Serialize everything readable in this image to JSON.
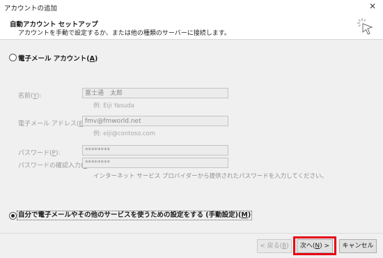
{
  "window": {
    "title": "アカウントの追加",
    "close_glyph": "✕"
  },
  "header": {
    "title": "自動アカウント セットアップ",
    "subtitle": "アカウントを手動で設定するか、または他の種類のサーバーに接続します。"
  },
  "options": {
    "email_account": {
      "label": "電子メール アカウント(",
      "key": "A",
      "close": ")",
      "selected": false
    },
    "manual": {
      "label": "自分で電子メールやその他のサービスを使うための設定をする (手動設定)(",
      "key": "M",
      "close": ")",
      "selected": true
    }
  },
  "form": {
    "name": {
      "label_pre": "名前(",
      "key": "Y",
      "label_post": "):",
      "value": "富士通　太郎",
      "hint": "例: Eiji Yasuda"
    },
    "email": {
      "label_pre": "電子メール アドレス(",
      "key": "E",
      "label_post": "):",
      "value": "fmv@fmworld.net",
      "hint": "例: eiji@contoso.com"
    },
    "password": {
      "label_pre": "パスワード(",
      "key": "P",
      "label_post": "):",
      "value": "********"
    },
    "password_confirm": {
      "label_pre": "パスワードの確認入力(",
      "key": "T",
      "label_post": "):",
      "value": "********"
    },
    "password_hint": "インターネット サービス プロバイダーから提供されたパスワードを入力してください。"
  },
  "buttons": {
    "back": {
      "pre": "< 戻る(",
      "key": "B",
      "post": ")",
      "enabled": false
    },
    "next": {
      "pre": "次へ(",
      "key": "N",
      "post": ") >",
      "enabled": true
    },
    "cancel": {
      "label": "キャンセル",
      "enabled": true
    }
  },
  "colors": {
    "highlight": "#e60012",
    "panel": "#f0f0f0"
  }
}
